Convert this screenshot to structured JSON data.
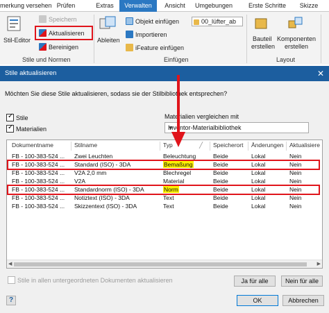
{
  "ribbon": {
    "tabs": [
      "merkung versehen",
      "Prüfen",
      "Extras",
      "Verwalten",
      "Ansicht",
      "Umgebungen",
      "Erste Schritte",
      "Skizze"
    ],
    "active_tab": "Verwalten",
    "styles_group": {
      "stil_editor": "Stil-Editor",
      "speichern": "Speichern",
      "aktualisieren": "Aktualisieren",
      "bereinigen": "Bereinigen",
      "label": "Stile und Normen"
    },
    "insert_group": {
      "ableiten": "Ableiten",
      "objekt_einfuegen": "Objekt einfügen",
      "importieren": "Importieren",
      "ifeature_einfuegen": "iFeature einfügen",
      "file_combo": "00_lüfter_ab",
      "label": "Einfügen"
    },
    "layout_group": {
      "bauteil_erstellen_1": "Bauteil",
      "bauteil_erstellen_2": "erstellen",
      "komponenten_erstellen_1": "Komponenten",
      "komponenten_erstellen_2": "erstellen",
      "label": "Layout"
    }
  },
  "dialog": {
    "title": "Stile aktualisieren",
    "question": "Möchten Sie diese Stile aktualisieren, sodass sie der Stilbibliothek entsprechen?",
    "checkbox_stile": {
      "label": "Stile",
      "checked": true
    },
    "checkbox_materialien": {
      "label": "Materialien",
      "checked": true
    },
    "compare_label": "Materialien vergleichen mit",
    "compare_value": "Inventor-Materialbibliothek",
    "columns": [
      "Dokumentname",
      "Stilname",
      "Typ",
      "Speicherort",
      "Änderungen",
      "Aktualisiere"
    ],
    "rows": [
      {
        "doc": "FB - 100-383-524 ...",
        "stil": "Zwei Leuchten",
        "typ": "Beleuchtung",
        "ort": "Beide",
        "aend": "Lokal",
        "akt": "Nein",
        "highlight": false
      },
      {
        "doc": "FB - 100-383-524 ...",
        "stil": "Standard (ISO) - 3DA",
        "typ": "Bemaßung",
        "ort": "Beide",
        "aend": "Lokal",
        "akt": "Nein",
        "highlight": true
      },
      {
        "doc": "FB - 100-383-524 ...",
        "stil": "V2A 2,0 mm",
        "typ": "Blechregel",
        "ort": "Beide",
        "aend": "Lokal",
        "akt": "Nein",
        "highlight": false
      },
      {
        "doc": "FB - 100-383-524 ...",
        "stil": "V2A",
        "typ": "Material",
        "ort": "Beide",
        "aend": "Lokal",
        "akt": "Nein",
        "highlight": false
      },
      {
        "doc": "FB - 100-383-524 ...",
        "stil": "Standardnorm (ISO) - 3DA",
        "typ": "Norm",
        "ort": "Beide",
        "aend": "Lokal",
        "akt": "Nein",
        "highlight": true
      },
      {
        "doc": "FB - 100-383-524 ...",
        "stil": "Notiztext (ISO) - 3DA",
        "typ": "Text",
        "ort": "Beide",
        "aend": "Lokal",
        "akt": "Nein",
        "highlight": false
      },
      {
        "doc": "FB - 100-383-524 ...",
        "stil": "Skizzentext (ISO) - 3DA",
        "typ": "Text",
        "ort": "Beide",
        "aend": "Lokal",
        "akt": "Nein",
        "highlight": false
      }
    ],
    "subdocs_checkbox": {
      "label": "Stile in allen untergeordneten Dokumenten aktualisieren",
      "checked": false,
      "enabled": false
    },
    "btn_ja_fuer_alle": "Ja für alle",
    "btn_nein_fuer_alle": "Nein für alle",
    "btn_ok": "OK",
    "btn_abbrechen": "Abbrechen",
    "help_glyph": "?"
  },
  "colors": {
    "active_tab": "#2b78c2",
    "title_bar": "#1c5e9f",
    "annotation_red": "#e0141b",
    "highlight_yellow": "#fff200"
  }
}
